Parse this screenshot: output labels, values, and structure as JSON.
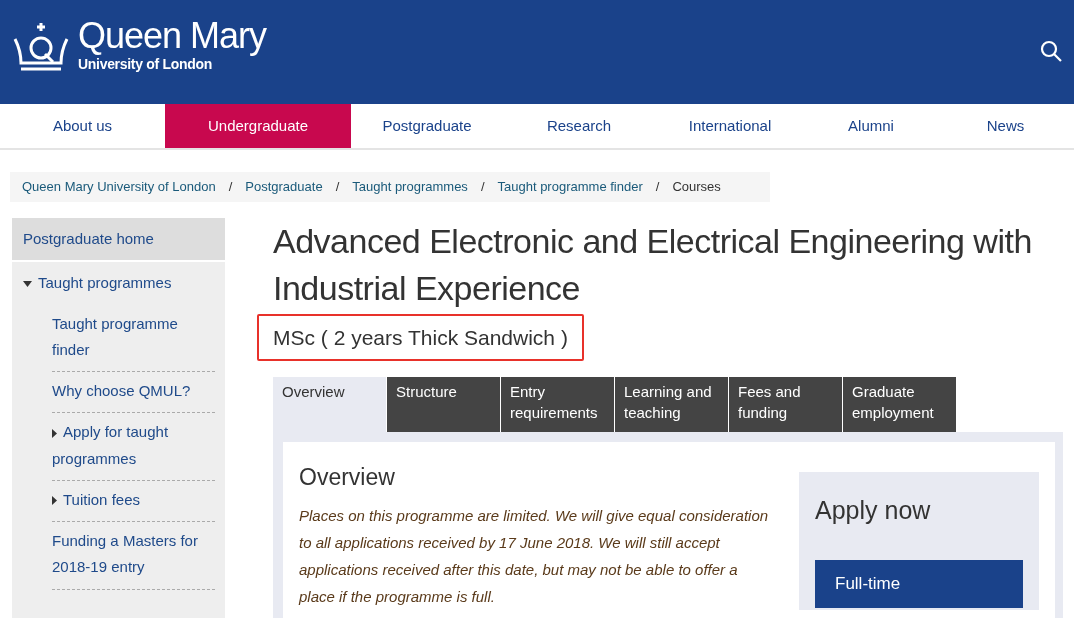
{
  "header": {
    "logo_title": "Queen Mary",
    "logo_subtitle": "University of London"
  },
  "nav": [
    {
      "label": "About us",
      "selected": false
    },
    {
      "label": "Undergraduate",
      "selected": true
    },
    {
      "label": "Postgraduate",
      "selected": false
    },
    {
      "label": "Research",
      "selected": false
    },
    {
      "label": "International",
      "selected": false
    },
    {
      "label": "Alumni",
      "selected": false
    },
    {
      "label": "News",
      "selected": false
    }
  ],
  "breadcrumb": [
    {
      "label": "Queen Mary University of London",
      "current": false
    },
    {
      "separator": "/"
    },
    {
      "label": "Postgraduate",
      "current": false
    },
    {
      "separator": "/"
    },
    {
      "label": "Taught programmes",
      "current": false
    },
    {
      "separator": "/"
    },
    {
      "label": "Taught programme finder",
      "current": false
    },
    {
      "separator": "/"
    },
    {
      "label": "Courses",
      "current": true
    }
  ],
  "sidebar": {
    "items": [
      {
        "label": "Postgraduate home",
        "kind": "leaf",
        "selected": true
      },
      {
        "label": "Taught programmes",
        "kind": "group",
        "expanded": true,
        "selected": false,
        "children": [
          {
            "label": "Taught programme finder",
            "kind": "leaf",
            "selected": false
          },
          {
            "label": "Why choose QMUL?",
            "kind": "leaf",
            "selected": false
          },
          {
            "label": "Apply for taught programmes",
            "kind": "group",
            "expanded": false,
            "selected": false
          },
          {
            "label": "Tuition fees",
            "kind": "group",
            "expanded": false,
            "selected": false
          },
          {
            "label": "Funding a Masters for 2018-19 entry",
            "kind": "leaf",
            "selected": false
          }
        ]
      }
    ]
  },
  "page": {
    "title": "Advanced Electronic and Electrical Engineering with Industrial Experience",
    "subtitle": "MSc ( 2 years Thick Sandwich )",
    "subtitle_highlighted": true
  },
  "tabs": [
    {
      "label": "Overview",
      "selected": true
    },
    {
      "label": "Structure",
      "selected": false
    },
    {
      "label": "Entry requirements",
      "selected": false
    },
    {
      "label": "Learning and teaching",
      "selected": false
    },
    {
      "label": "Fees and funding",
      "selected": false
    },
    {
      "label": "Graduate employment",
      "selected": false
    }
  ],
  "overview": {
    "heading": "Overview",
    "text": "Places on this programme are limited. We will give equal consideration to all applications received by 17 June 2018. We will still accept applications received after this date, but may not be able to offer a place if the programme is full."
  },
  "apply": {
    "heading": "Apply now",
    "button": "Full-time"
  }
}
